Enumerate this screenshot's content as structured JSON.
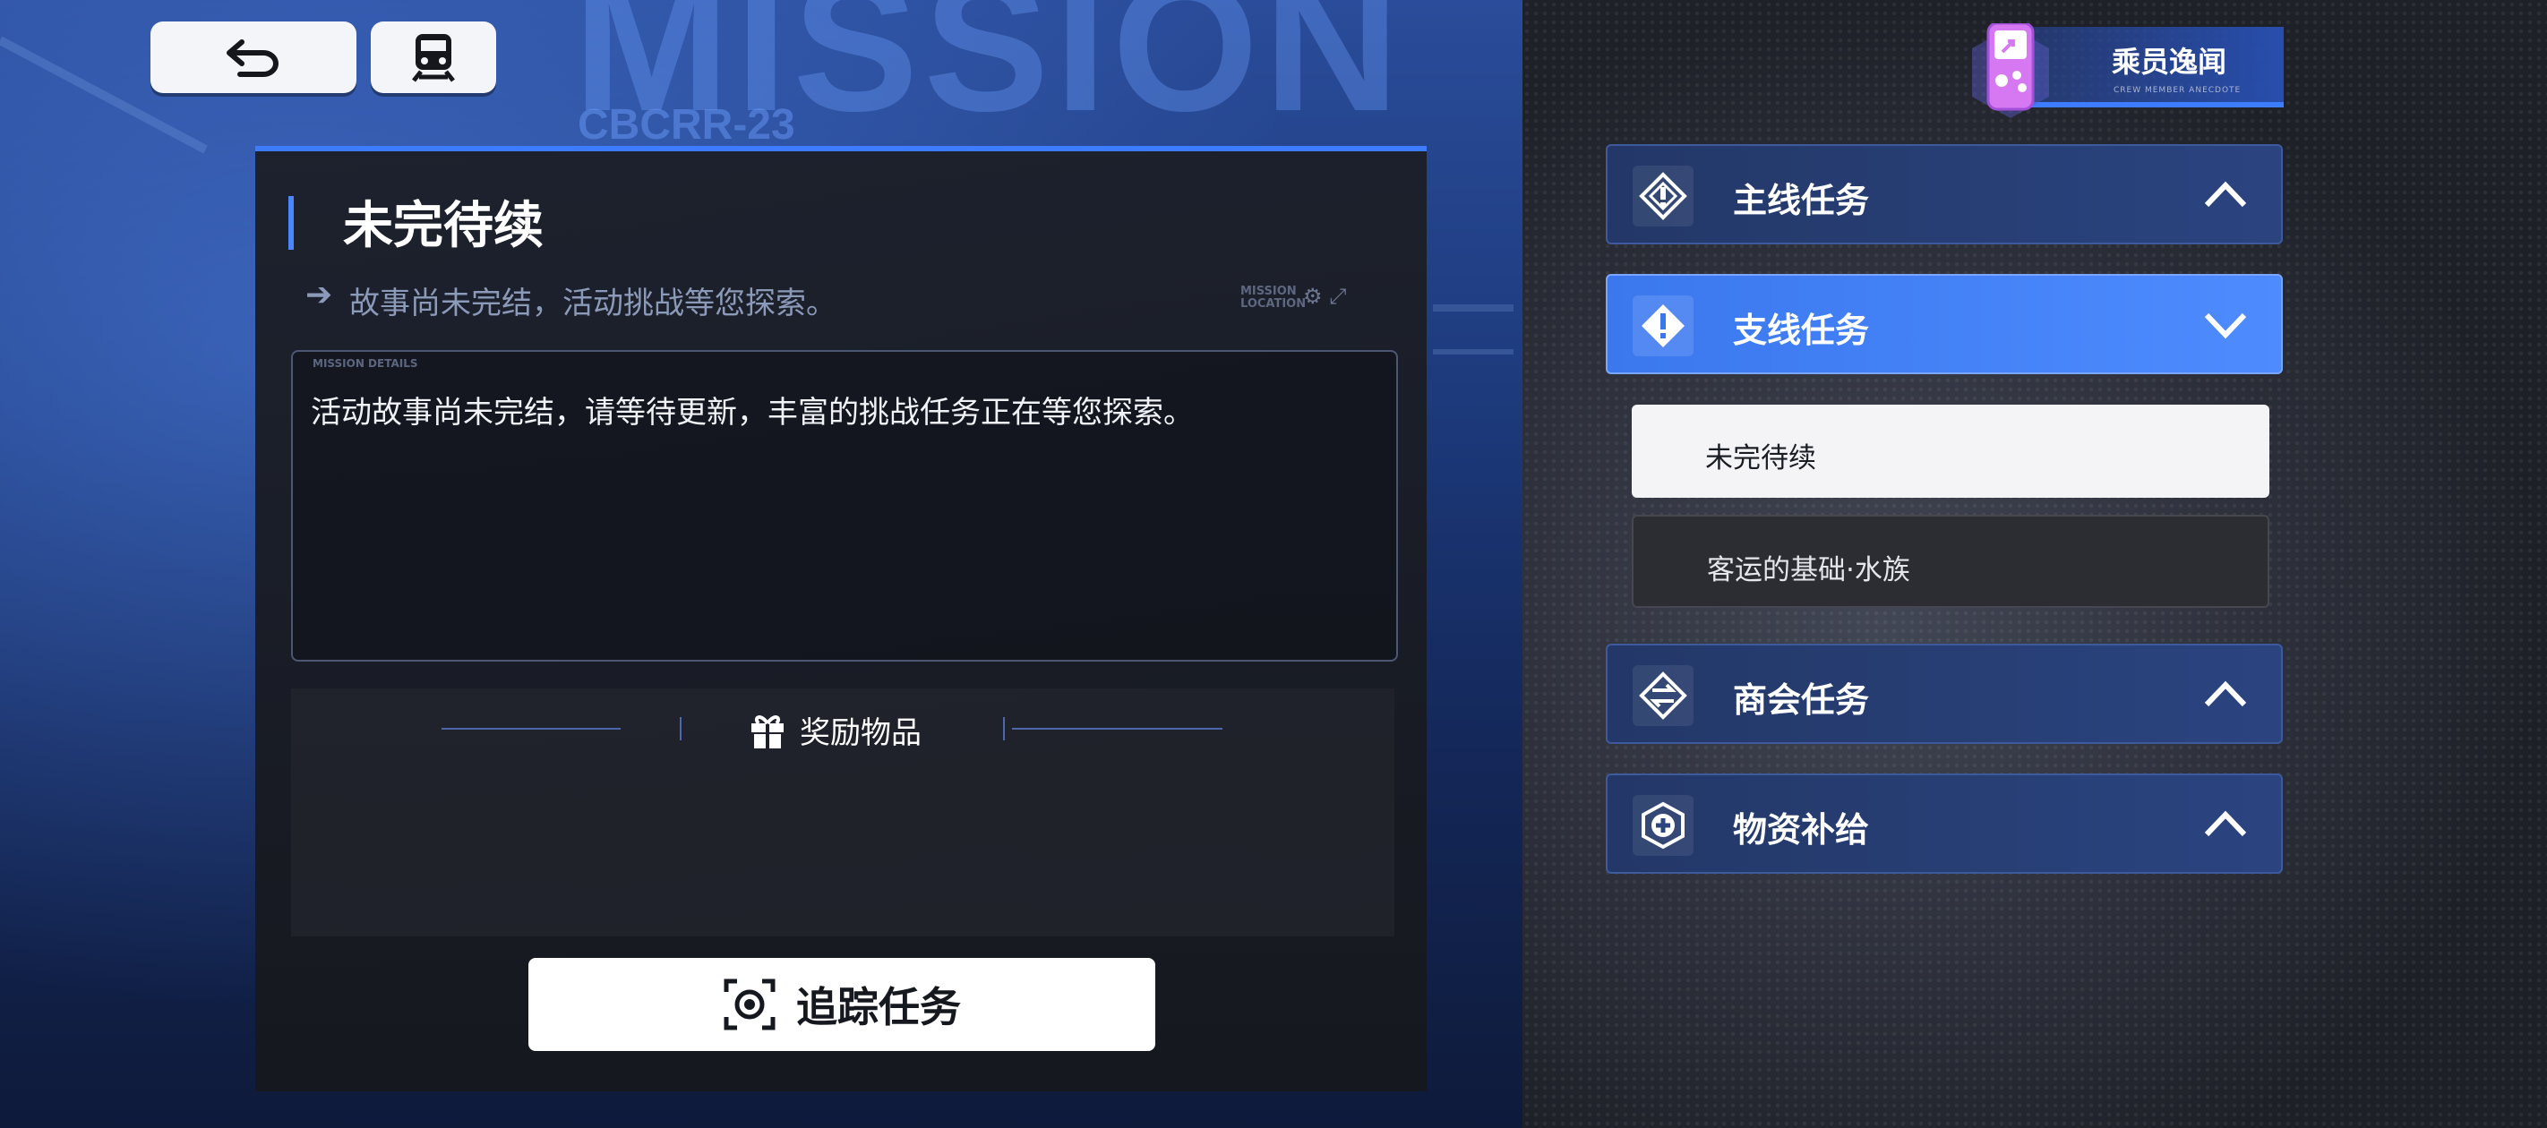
{
  "background": {
    "watermark_title": "MISSION",
    "watermark_code": "CBCRR-23"
  },
  "topbar": {
    "back_icon": "back-arrow-icon",
    "train_icon": "train-icon"
  },
  "mission": {
    "title": "未完待续",
    "subtitle": "故事尚未完结，活动挑战等您探索。",
    "location_mark": "MISSION LOCATION",
    "details_label": "MISSION DETAILS",
    "details_text": "活动故事尚未完结，请等待更新，丰富的挑战任务正在等您探索。",
    "rewards_title": "奖励物品",
    "track_button": "追踪任务"
  },
  "crew": {
    "label": "乘员逸闻",
    "sub": "CREW MEMBER ANECDOTE"
  },
  "categories": [
    {
      "label": "主线任务",
      "expanded": false
    },
    {
      "label": "支线任务",
      "expanded": true
    },
    {
      "label": "商会任务",
      "expanded": false
    },
    {
      "label": "物资补给",
      "expanded": false
    }
  ],
  "side_missions": [
    {
      "label": "未完待续",
      "selected": true
    },
    {
      "label": "客运的基础·水族",
      "selected": false
    }
  ],
  "colors": {
    "accent": "#3d7bff",
    "active_category": "#4d8bff",
    "crew_badge": "#c86cf0"
  }
}
